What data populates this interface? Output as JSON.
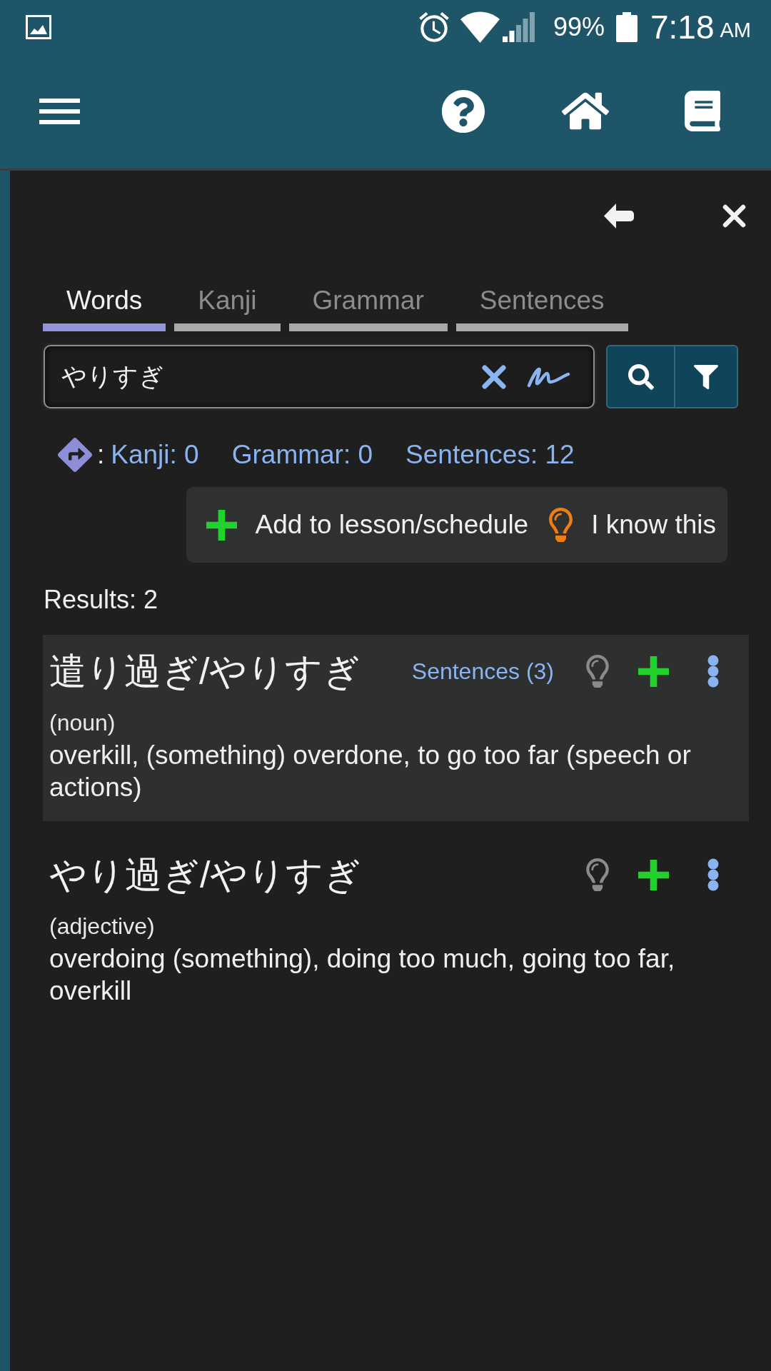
{
  "status_bar": {
    "battery": "99%",
    "time": "7:18",
    "period": "AM"
  },
  "tabs": [
    {
      "label": "Words",
      "selected": true
    },
    {
      "label": "Kanji",
      "selected": false
    },
    {
      "label": "Grammar",
      "selected": false
    },
    {
      "label": "Sentences",
      "selected": false
    }
  ],
  "search": {
    "value": "やりすぎ"
  },
  "related": {
    "separator": ":",
    "links": [
      "Kanji: 0",
      "Grammar: 0",
      "Sentences: 12"
    ]
  },
  "actions": [
    {
      "kind": "add",
      "label": "Add to lesson/schedule"
    },
    {
      "kind": "know",
      "label": "I know this"
    }
  ],
  "results_count": "Results: 2",
  "results": [
    {
      "term": "遣り過ぎ/やりすぎ",
      "sentences_link": "Sentences (3)",
      "selected": true,
      "part_of_speech": "(noun)",
      "definition": "overkill, (something) overdone, to go too far (speech or actions)"
    },
    {
      "term": "やり過ぎ/やりすぎ",
      "selected": false,
      "part_of_speech": "(adjective)",
      "definition": "overdoing (something), doing too much, going too far, overkill"
    }
  ]
}
